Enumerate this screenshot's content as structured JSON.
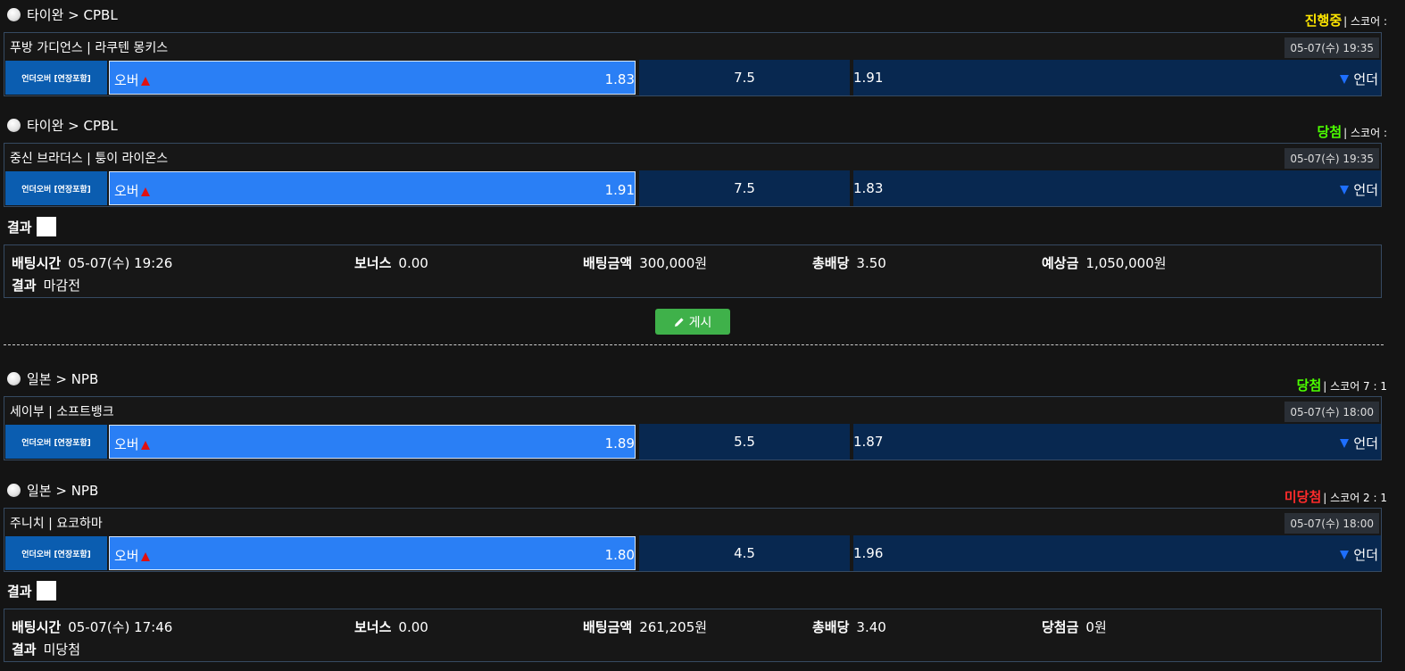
{
  "colors": {
    "status_live": "#ffe600",
    "status_win": "#4cff00",
    "status_lose": "#ff2b2b",
    "over_bg": "#2a7ff5",
    "under_bg": "#082850",
    "btype_bg": "#0b5db0",
    "post_button": "#3fb14a"
  },
  "icons": {
    "league": "baseball-icon",
    "over": "triangle-up-icon",
    "under": "triangle-down-icon",
    "post": "pencil-icon"
  },
  "slips": [
    {
      "bets": [
        {
          "league": "타이완 > CPBL",
          "status": "진행중",
          "score_label": "| 스코어 :",
          "teams": "푸방 가디언스 | 라쿠텐 몽키스",
          "datetime": "05-07(수) 19:35",
          "bet_type": "언더오버 [연장포함]",
          "over_label": "오버",
          "over_odd": "1.83",
          "line": "7.5",
          "under_odd": "1.91",
          "under_label": "언더"
        },
        {
          "league": "타이완 > CPBL",
          "status": "당첨",
          "score_label": "| 스코어 :",
          "teams": "중신 브라더스 | 퉁이 라이온스",
          "datetime": "05-07(수) 19:35",
          "bet_type": "언더오버 [연장포함]",
          "over_label": "오버",
          "over_odd": "1.91",
          "line": "7.5",
          "under_odd": "1.83",
          "under_label": "언더"
        }
      ],
      "result_label": "결과",
      "summary": {
        "bet_time_label": "배팅시간",
        "bet_time": "05-07(수) 19:26",
        "bonus_label": "보너스",
        "bonus": "0.00",
        "amount_label": "배팅금액",
        "amount": "300,000원",
        "total_odds_label": "총배당",
        "total_odds": "3.50",
        "payout_label": "예상금",
        "payout": "1,050,000",
        "payout_unit": "원",
        "result_label": "결과",
        "result": "마감전"
      },
      "post_button": "게시"
    },
    {
      "bets": [
        {
          "league": "일본 > NPB",
          "status": "당첨",
          "score_label": "| 스코어 7 : 1",
          "teams": "세이부 | 소프트뱅크",
          "datetime": "05-07(수) 18:00",
          "bet_type": "언더오버 [연장포함]",
          "over_label": "오버",
          "over_odd": "1.89",
          "line": "5.5",
          "under_odd": "1.87",
          "under_label": "언더"
        },
        {
          "league": "일본 > NPB",
          "status": "미당첨",
          "score_label": "| 스코어 2 : 1",
          "teams": "주니치 | 요코하마",
          "datetime": "05-07(수) 18:00",
          "bet_type": "언더오버 [연장포함]",
          "over_label": "오버",
          "over_odd": "1.80",
          "line": "4.5",
          "under_odd": "1.96",
          "under_label": "언더"
        }
      ],
      "result_label": "결과",
      "summary": {
        "bet_time_label": "배팅시간",
        "bet_time": "05-07(수) 17:46",
        "bonus_label": "보너스",
        "bonus": "0.00",
        "amount_label": "배팅금액",
        "amount": "261,205원",
        "total_odds_label": "총배당",
        "total_odds": "3.40",
        "payout_label": "당첨금",
        "payout": "0",
        "payout_unit": "원",
        "result_label": "결과",
        "result": "미당첨"
      }
    }
  ]
}
